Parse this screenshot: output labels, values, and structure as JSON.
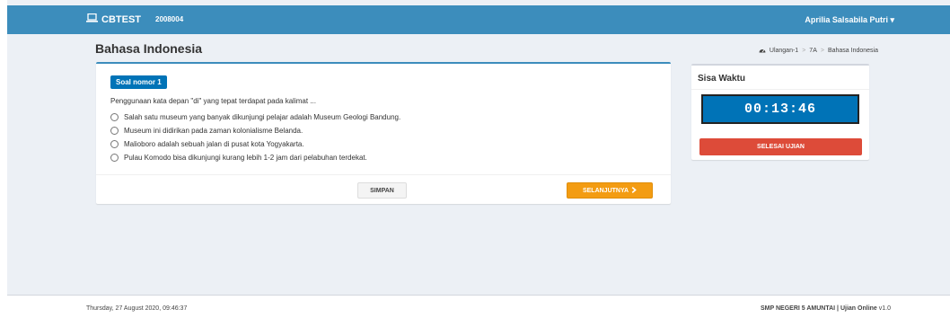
{
  "navbar": {
    "brand": "CBTEST",
    "brand_icon": "laptop-icon",
    "code": "2008004",
    "user_name": "Aprilia Salsabila Putri",
    "user_caret": "▾"
  },
  "page": {
    "title": "Bahasa Indonesia"
  },
  "breadcrumb": {
    "icon": "dashboard-icon",
    "items": [
      "Ulangan-1",
      "7A",
      "Bahasa Indonesia"
    ],
    "separator": ">"
  },
  "question": {
    "badge": "Soal nomor 1",
    "text": "Penggunaan kata depan \"di\" yang tepat terdapat pada kalimat ...",
    "options": [
      "Salah satu museum yang banyak dikunjungi pelajar adalah Museum Geologi Bandung.",
      "Museum ini didirikan pada zaman kolonialisme Belanda.",
      "Malioboro adalah sebuah jalan di pusat kota Yogyakarta.",
      "Pulau Komodo bisa dikunjungi kurang lebih 1-2 jam dari pelabuhan terdekat."
    ],
    "save_label": "SIMPAN",
    "next_label": "SELANJUTNYA"
  },
  "timer": {
    "title": "Sisa Waktu",
    "value": "00:13:46",
    "finish_label": "SELESAI UJIAN"
  },
  "footer": {
    "datetime": "Thursday, 27 August 2020, 09:46:37",
    "school": "SMP NEGERI 5 AMUNTAI | Ujian Online",
    "version": "v1.0"
  },
  "colors": {
    "navbar": "#3c8dbc",
    "badge": "#0073b7",
    "timer_bg": "#0073b7",
    "next_button": "#f39c12",
    "finish_button": "#dd4b39",
    "background": "#ecf0f5"
  }
}
